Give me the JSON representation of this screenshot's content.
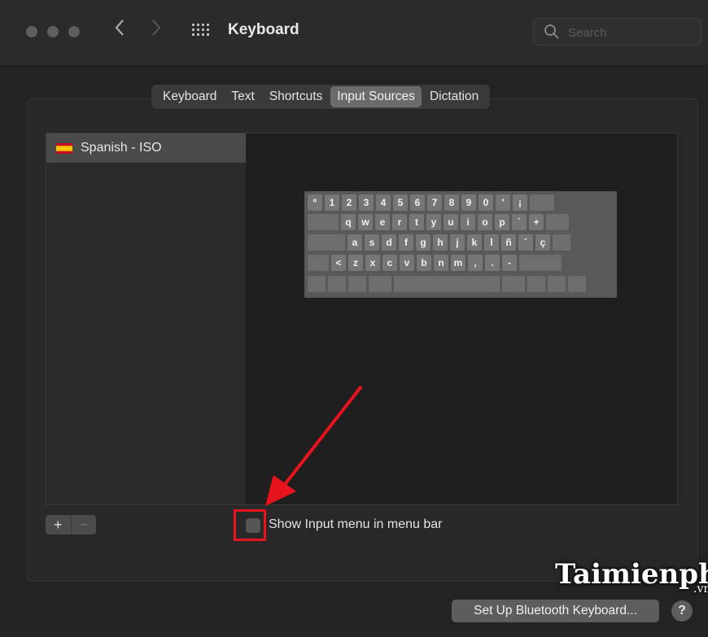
{
  "window": {
    "title": "Keyboard",
    "back_icon": "chevron-left-icon",
    "forward_icon": "chevron-right-icon",
    "grid_icon": "show-all-grid-icon"
  },
  "search": {
    "placeholder": "Search"
  },
  "tabs": [
    {
      "label": "Keyboard",
      "active": false
    },
    {
      "label": "Text",
      "active": false
    },
    {
      "label": "Shortcuts",
      "active": false
    },
    {
      "label": "Input Sources",
      "active": true
    },
    {
      "label": "Dictation",
      "active": false
    }
  ],
  "input_sources": [
    {
      "label": "Spanish - ISO",
      "flag": "spain-flag-icon",
      "selected": true
    }
  ],
  "keyboard_rows": [
    [
      "º",
      "1",
      "2",
      "3",
      "4",
      "5",
      "6",
      "7",
      "8",
      "9",
      "0",
      "'",
      "¡"
    ],
    [
      "q",
      "w",
      "e",
      "r",
      "t",
      "y",
      "u",
      "i",
      "o",
      "p",
      "`",
      "+"
    ],
    [
      "a",
      "s",
      "d",
      "f",
      "g",
      "h",
      "j",
      "k",
      "l",
      "ñ",
      "´",
      "ç"
    ],
    [
      "<",
      "z",
      "x",
      "c",
      "v",
      "b",
      "n",
      "m",
      ",",
      ".",
      "-"
    ]
  ],
  "controls": {
    "add_label": "+",
    "remove_label": "−",
    "show_input_menu_label": "Show Input menu in menu bar",
    "show_input_menu_checked": false,
    "bluetooth_button": "Set Up Bluetooth Keyboard...",
    "help_label": "?"
  },
  "watermark": {
    "text": "Taimienphi",
    "suffix": ".vn"
  },
  "colors": {
    "annotation_red": "#e8141d"
  }
}
